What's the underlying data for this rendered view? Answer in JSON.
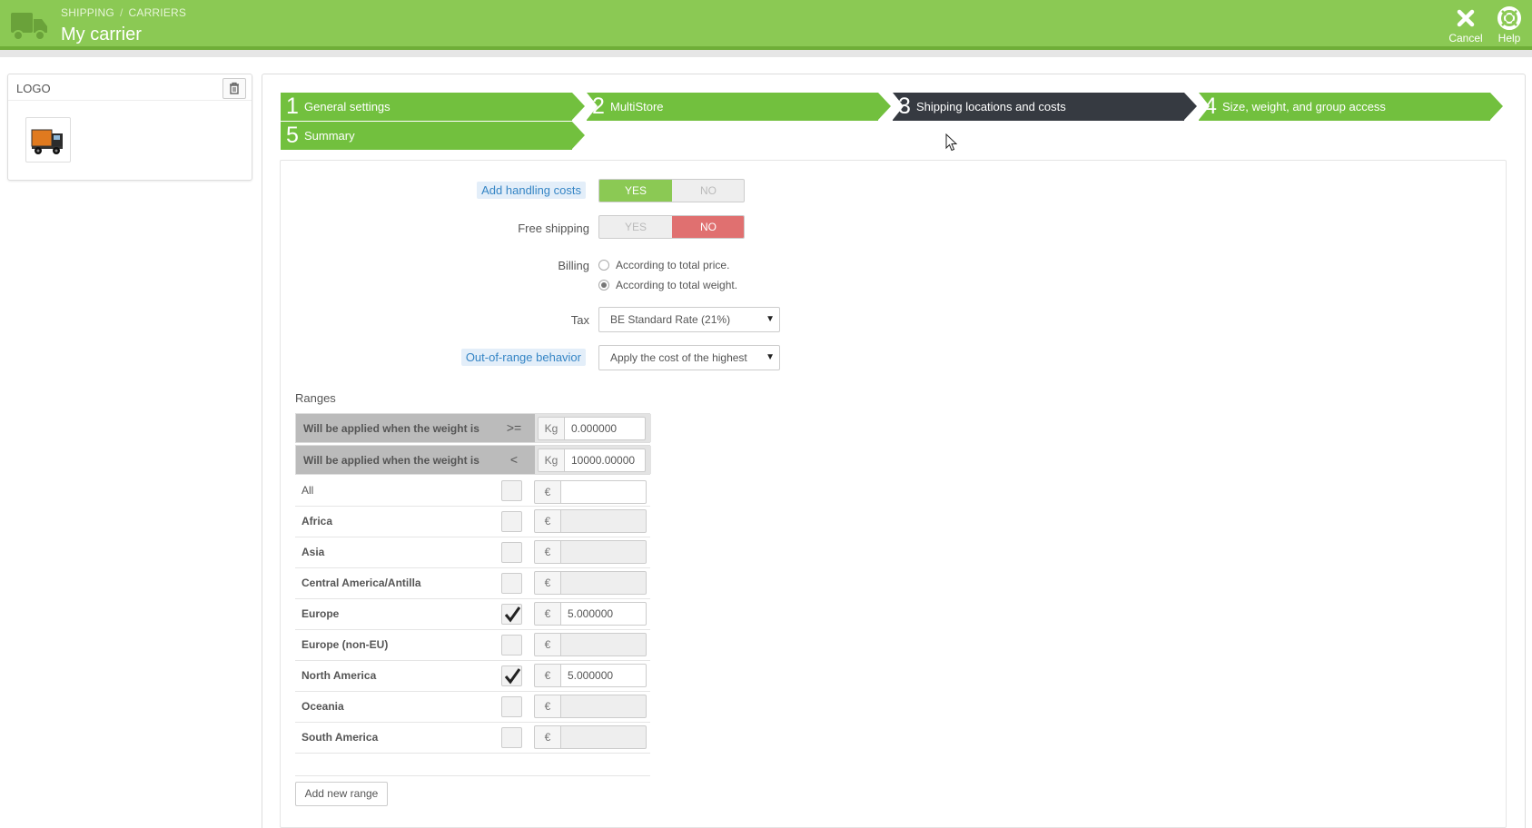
{
  "header": {
    "breadcrumb": [
      "SHIPPING",
      "CARRIERS"
    ],
    "breadcrumb_sep": "/",
    "title": "My carrier",
    "cancel_label": "Cancel",
    "help_label": "Help",
    "color": "#8bc954"
  },
  "logo_panel": {
    "title": "LOGO"
  },
  "steps": [
    {
      "num": "1",
      "label": "General settings"
    },
    {
      "num": "2",
      "label": "MultiStore"
    },
    {
      "num": "3",
      "label": "Shipping locations and costs",
      "active": true
    },
    {
      "num": "4",
      "label": "Size, weight, and group access"
    },
    {
      "num": "5",
      "label": "Summary"
    }
  ],
  "form": {
    "handling": {
      "label": "Add handling costs",
      "yes": "YES",
      "no": "NO",
      "value": "YES"
    },
    "free_shipping": {
      "label": "Free shipping",
      "yes": "YES",
      "no": "NO",
      "value": "NO"
    },
    "billing": {
      "label": "Billing",
      "options": [
        "According to total price.",
        "According to total weight."
      ],
      "selected": "According to total weight."
    },
    "tax": {
      "label": "Tax",
      "value": "BE Standard Rate (21%)"
    },
    "out_of_range": {
      "label": "Out-of-range behavior",
      "value": "Apply the cost of the highest"
    }
  },
  "ranges": {
    "title": "Ranges",
    "row_from": {
      "label": "Will be applied when the weight is",
      "op": ">=",
      "unit": "Kg",
      "value": "0.000000"
    },
    "row_to": {
      "label": "Will be applied when the weight is",
      "op": "<",
      "unit": "Kg",
      "value": "10000.00000"
    },
    "currency": "€",
    "zones": [
      {
        "name": "All",
        "checked": false,
        "value": "",
        "enabled": true
      },
      {
        "name": "Africa",
        "checked": false,
        "value": "",
        "enabled": false
      },
      {
        "name": "Asia",
        "checked": false,
        "value": "",
        "enabled": false
      },
      {
        "name": "Central America/Antilla",
        "checked": false,
        "value": "",
        "enabled": false
      },
      {
        "name": "Europe",
        "checked": true,
        "value": "5.000000",
        "enabled": true
      },
      {
        "name": "Europe (non-EU)",
        "checked": false,
        "value": "",
        "enabled": false
      },
      {
        "name": "North America",
        "checked": true,
        "value": "5.000000",
        "enabled": true
      },
      {
        "name": "Oceania",
        "checked": false,
        "value": "",
        "enabled": false
      },
      {
        "name": "South America",
        "checked": false,
        "value": "",
        "enabled": false
      }
    ],
    "add_button": "Add new range"
  }
}
